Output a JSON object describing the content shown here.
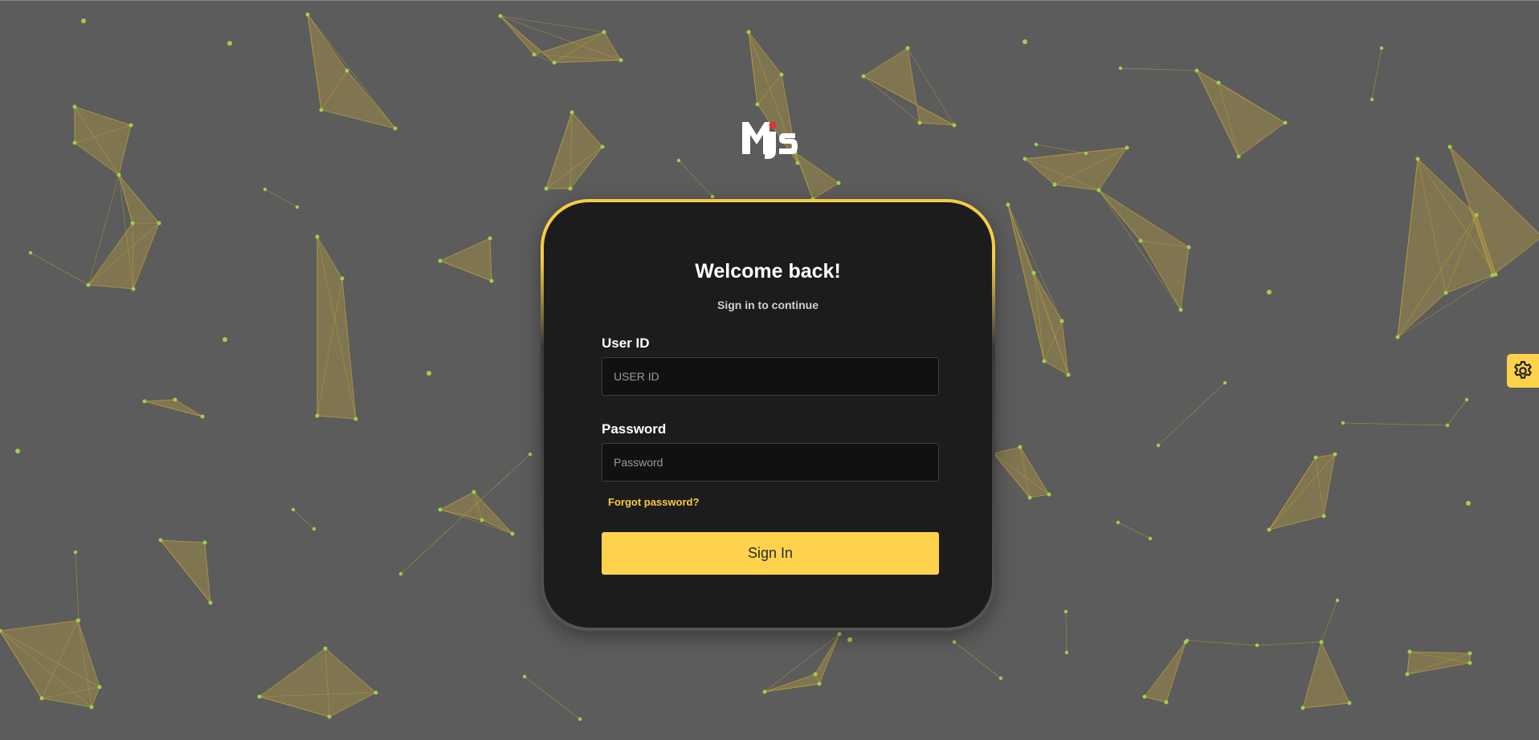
{
  "login": {
    "title": "Welcome back!",
    "subtitle": "Sign in to continue",
    "user_id_label": "User ID",
    "user_id_placeholder": "USER ID",
    "user_id_value": "",
    "password_label": "Password",
    "password_placeholder": "Password",
    "password_value": "",
    "forgot_label": "Forgot password?",
    "submit_label": "Sign In"
  },
  "logo": {
    "text": "MJS",
    "icon": "mjs-logo"
  },
  "settings": {
    "icon": "gear-icon"
  },
  "colors": {
    "background": "#5c5c5c",
    "card": "#1c1c1c",
    "accent": "#ffd24c",
    "network_fill": "#c9a93a",
    "network_node": "#9fd04a",
    "logo_dot": "#e23232"
  }
}
